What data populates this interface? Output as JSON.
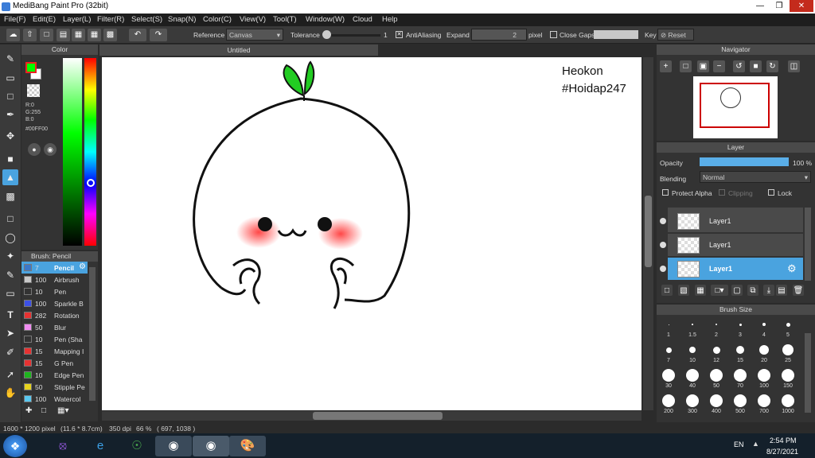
{
  "window": {
    "title": "MediBang Paint Pro (32bit)"
  },
  "menu": [
    "File(F)",
    "Edit(E)",
    "Layer(L)",
    "Filter(R)",
    "Select(S)",
    "Snap(N)",
    "Color(C)",
    "View(V)",
    "Tool(T)",
    "Window(W)",
    "Cloud",
    "Help"
  ],
  "toolbar": {
    "reference_label": "Reference",
    "reference_value": "Canvas",
    "tolerance_label": "Tolerance",
    "tolerance_value": "1",
    "antialias_label": "AntiAliasing",
    "expand_label": "Expand",
    "expand_value": "2",
    "expand_unit": "pixel",
    "closegaps_label": "Close Gaps",
    "key_label": "Key",
    "reset_label": "Reset"
  },
  "color_panel": {
    "title": "Color",
    "r": "R:0",
    "g": "G:255",
    "b": "B:0",
    "hex": "#00FF00",
    "primary_color": "#00ff00",
    "secondary_color": "#ffffff"
  },
  "brush_panel": {
    "title": "Brush: Pencil",
    "items": [
      {
        "size": "7",
        "name": "Pencil",
        "color": "#3c78c8"
      },
      {
        "size": "100",
        "name": "Airbrush",
        "color": "#c8c8c8"
      },
      {
        "size": "10",
        "name": "Pen",
        "color": "#333333"
      },
      {
        "size": "100",
        "name": "Sparkle B",
        "color": "#3c50e6"
      },
      {
        "size": "282",
        "name": "Rotation",
        "color": "#e63232"
      },
      {
        "size": "50",
        "name": "Blur",
        "color": "#f08cf0"
      },
      {
        "size": "10",
        "name": "Pen (Sha",
        "color": "#333333"
      },
      {
        "size": "15",
        "name": "Mapping I",
        "color": "#e63232"
      },
      {
        "size": "15",
        "name": "G Pen",
        "color": "#e63232"
      },
      {
        "size": "10",
        "name": "Edge Pen",
        "color": "#1eb41e"
      },
      {
        "size": "50",
        "name": "Stipple Pe",
        "color": "#e6d21e"
      },
      {
        "size": "100",
        "name": "Watercol",
        "color": "#5ac8f0"
      }
    ]
  },
  "document": {
    "tab_title": "Untitled"
  },
  "canvas_text": {
    "line1": "Heokon",
    "line2": "#Hoidap247"
  },
  "navigator": {
    "title": "Navigator"
  },
  "layer_panel": {
    "title": "Layer",
    "opacity_label": "Opacity",
    "opacity_value": "100 %",
    "opacity_fraction": 1.0,
    "blending_label": "Blending",
    "blending_value": "Normal",
    "protect_alpha": "Protect Alpha",
    "clipping": "Clipping",
    "lock": "Lock",
    "layers": [
      {
        "name": "Layer1",
        "selected": false
      },
      {
        "name": "Layer1",
        "selected": false
      },
      {
        "name": "Layer1",
        "selected": true
      }
    ]
  },
  "brush_size_panel": {
    "title": "Brush Size",
    "sizes": [
      "1",
      "1.5",
      "2",
      "3",
      "4",
      "5",
      "7",
      "10",
      "12",
      "15",
      "20",
      "25",
      "30",
      "40",
      "50",
      "70",
      "100",
      "150",
      "200",
      "300",
      "400",
      "500",
      "700",
      "1000"
    ]
  },
  "status": {
    "dimensions": "1600 * 1200 pixel",
    "physical": "(11.6 * 8.7cm)",
    "dpi": "350 dpi",
    "zoom": "66 %",
    "cursor": "( 697, 1038 )"
  },
  "taskbar": {
    "lang": "EN",
    "time": "2:54 PM",
    "date": "8/27/2021"
  }
}
